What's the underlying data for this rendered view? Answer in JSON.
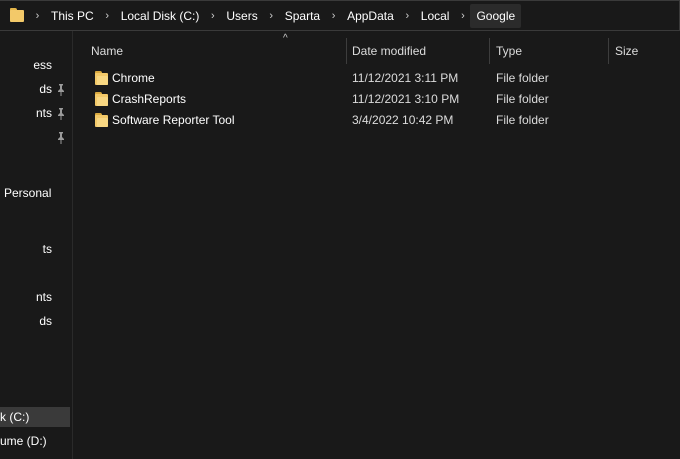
{
  "address": {
    "crumbs": [
      "This PC",
      "Local Disk (C:)",
      "Users",
      "Sparta",
      "AppData",
      "Local",
      "Google"
    ],
    "separator": "›"
  },
  "nav": {
    "items": [
      {
        "label": "ess",
        "pinned": false
      },
      {
        "label": "ds",
        "pinned": true
      },
      {
        "label": "nts",
        "pinned": true
      },
      {
        "label": "",
        "pinned": true
      },
      {
        "label": "Personal",
        "pinned": false
      },
      {
        "label": "ts",
        "pinned": false
      },
      {
        "label": "nts",
        "pinned": false
      },
      {
        "label": "ds",
        "pinned": false
      },
      {
        "label": "k (C:)",
        "pinned": false
      },
      {
        "label": "ume (D:)",
        "pinned": false
      }
    ]
  },
  "columns": {
    "name": "Name",
    "date_modified": "Date modified",
    "type": "Type",
    "size": "Size",
    "sort_indicator": "^"
  },
  "files": [
    {
      "name": "Chrome",
      "date": "11/12/2021 3:11 PM",
      "type": "File folder"
    },
    {
      "name": "CrashReports",
      "date": "11/12/2021 3:10 PM",
      "type": "File folder"
    },
    {
      "name": "Software Reporter Tool",
      "date": "3/4/2022 10:42 PM",
      "type": "File folder"
    }
  ],
  "colors": {
    "background": "#191919",
    "folder": "#f3c969",
    "selected": "#3a3a3a"
  }
}
